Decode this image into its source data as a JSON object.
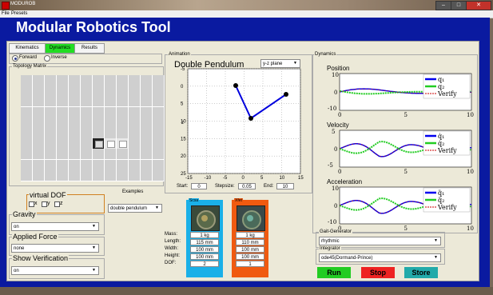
{
  "window": {
    "app_name": "MODUROB"
  },
  "menu": [
    "File",
    "Presets"
  ],
  "app_title": "Modular Robotics Tool",
  "tabs": [
    "Kinematics",
    "Dynamics",
    "Results"
  ],
  "mode": {
    "forward": "Forward",
    "inverse": "Inverse"
  },
  "topology_label": "Topology Matrix",
  "virtual_dof": {
    "label": "virtual DOF",
    "x": "x",
    "y": "y",
    "z": "z"
  },
  "examples": {
    "label": "Examples",
    "value": "double pendulum"
  },
  "gravity": {
    "label": "Gravity",
    "value": "on"
  },
  "applied_force": {
    "label": "Applied Force",
    "value": "none"
  },
  "show_verification": {
    "label": "Show Verification",
    "value": "on"
  },
  "animation": {
    "group_label": "Animation",
    "title": "Double Pendulum",
    "plane": "y-z plane",
    "xticks": [
      "-15",
      "-10",
      "-5",
      "0",
      "5",
      "10",
      "15"
    ],
    "yticks": [
      "-5",
      "0",
      "5",
      "10",
      "15",
      "20",
      "25"
    ],
    "axis_label": "z",
    "start_label": "Start:",
    "start_value": "0",
    "step_label": "Stepsize:",
    "step_value": "0.05",
    "end_label": "End:",
    "end_value": "10"
  },
  "modules": {
    "props": [
      "Mass:",
      "Length:",
      "Width:",
      "Height:",
      "DOF:"
    ],
    "m1": {
      "name": "Scsa",
      "mass": "1 kg",
      "length": "115 mm",
      "width": "100 mm",
      "height": "100 mm",
      "dof": "2",
      "color": "#1ab0e8"
    },
    "m2": {
      "name": "Xfet",
      "mass": "1 kg",
      "length": "110 mm",
      "width": "100 mm",
      "height": "100 mm",
      "dof": "1",
      "color": "#f05a10"
    }
  },
  "dynamics": {
    "group_label": "Dynamics",
    "position": {
      "title": "Position",
      "ytop": "10",
      "ymid": "0",
      "ybot": "-10",
      "x0": "0",
      "x5": "5",
      "x10": "10",
      "legend": [
        "q₁",
        "q₂",
        "Verify"
      ]
    },
    "velocity": {
      "title": "Velocity",
      "ytop": "5",
      "ymid": "0",
      "ybot": "-5",
      "x0": "0",
      "x5": "5",
      "x10": "10",
      "legend": [
        "q̇₁",
        "q̇₂",
        "Verify"
      ]
    },
    "acceleration": {
      "title": "Acceleration",
      "ytop": "10",
      "ymid": "0",
      "ybot": "-10",
      "x0": "0",
      "x5": "5",
      "x10": "10",
      "legend": [
        "q̈₁",
        "q̈₂",
        "Verify"
      ]
    }
  },
  "gait": {
    "label": "Gait-Generator",
    "value": "rhythmic"
  },
  "integrator": {
    "label": "Integrator",
    "value": "ode45(Dormand-Prince)"
  },
  "buttons": {
    "run": "Run",
    "stop": "Stop",
    "store": "Store"
  },
  "colors": {
    "q1": "#0000ee",
    "q2": "#22cc22",
    "verify": "#cc0000",
    "run": "#22cc22",
    "stop": "#ee2222",
    "store": "#22aaaa",
    "dynamics_tab": "#22dd22"
  }
}
